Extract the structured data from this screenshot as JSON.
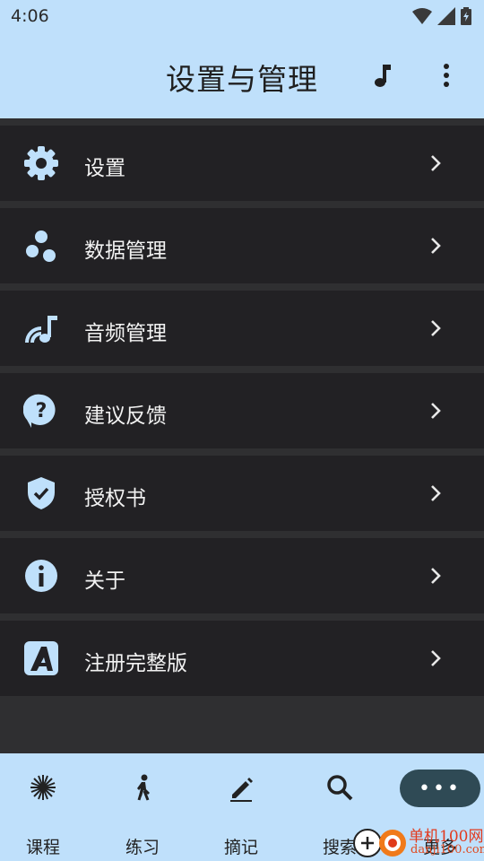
{
  "status_bar": {
    "time": "4:06"
  },
  "app_bar": {
    "title": "设置与管理"
  },
  "menu": [
    {
      "label": "设置",
      "icon": "gear-icon"
    },
    {
      "label": "数据管理",
      "icon": "data-dots-icon"
    },
    {
      "label": "音频管理",
      "icon": "audio-wave-icon"
    },
    {
      "label": "建议反馈",
      "icon": "feedback-question-icon"
    },
    {
      "label": "授权书",
      "icon": "shield-check-icon"
    },
    {
      "label": "关于",
      "icon": "info-icon"
    },
    {
      "label": "注册完整版",
      "icon": "register-a-icon"
    }
  ],
  "bottom_nav": [
    {
      "label": "课程",
      "icon": "sparkle-icon"
    },
    {
      "label": "练习",
      "icon": "walking-person-icon"
    },
    {
      "label": "摘记",
      "icon": "pencil-icon"
    },
    {
      "label": "搜索",
      "icon": "search-icon"
    },
    {
      "label": "更多",
      "icon": "more-dots-icon"
    }
  ],
  "watermark": {
    "text": "单机100网",
    "sub": "danji100.com"
  },
  "colors": {
    "accent": "#bfe0fb",
    "item_bg": "#222124",
    "page_bg": "#2f2f31",
    "icon": "#bfe0fb"
  }
}
